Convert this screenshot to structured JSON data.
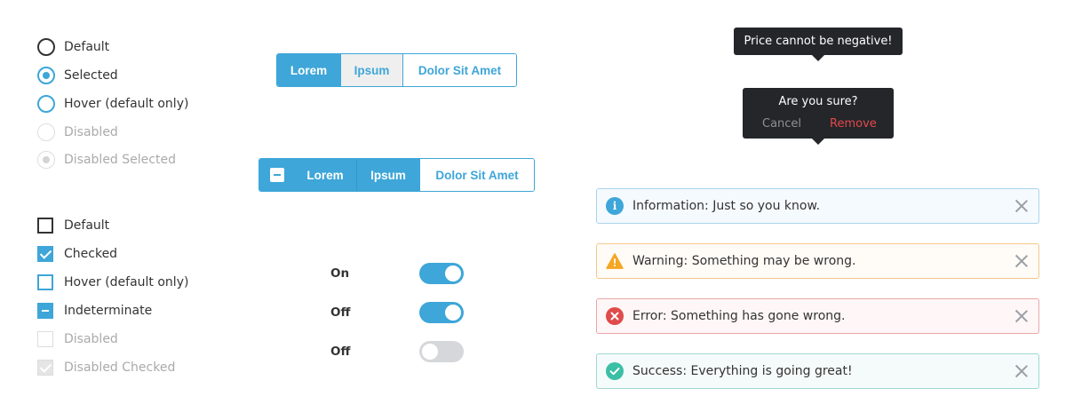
{
  "radios": [
    {
      "label": "Default",
      "state": "default"
    },
    {
      "label": "Selected",
      "state": "selected"
    },
    {
      "label": "Hover (default only)",
      "state": "hover"
    },
    {
      "label": "Disabled",
      "state": "disabled"
    },
    {
      "label": "Disabled Selected",
      "state": "disabled-selected"
    }
  ],
  "checkboxes": [
    {
      "label": "Default",
      "state": "default"
    },
    {
      "label": "Checked",
      "state": "checked"
    },
    {
      "label": "Hover (default only)",
      "state": "hover"
    },
    {
      "label": "Indeterminate",
      "state": "indeterminate"
    },
    {
      "label": "Disabled",
      "state": "disabled"
    },
    {
      "label": "Disabled Checked",
      "state": "disabled-checked"
    }
  ],
  "button_group_1": [
    "Lorem",
    "Ipsum",
    "Dolor Sit Amet"
  ],
  "button_group_2": [
    "Lorem",
    "Ipsum",
    "Dolor Sit Amet"
  ],
  "toggles": [
    {
      "label": "On",
      "on": true
    },
    {
      "label": "Off",
      "on": true
    },
    {
      "label": "Off",
      "on": false
    }
  ],
  "tooltip_error": "Price cannot be negative!",
  "confirm": {
    "question": "Are you sure?",
    "cancel": "Cancel",
    "remove": "Remove"
  },
  "alerts": [
    {
      "type": "info",
      "text": "Information: Just so you know."
    },
    {
      "type": "warning",
      "text": "Warning: Something may be wrong."
    },
    {
      "type": "error",
      "text": "Error: Something has gone wrong."
    },
    {
      "type": "success",
      "text": "Success: Everything is going great!"
    }
  ],
  "colors": {
    "accent": "#3ea6d8",
    "info": "#3ea6d8",
    "warning": "#f5a623",
    "error": "#e04b4b",
    "success": "#3cbfa5",
    "remove": "#e5484d"
  }
}
